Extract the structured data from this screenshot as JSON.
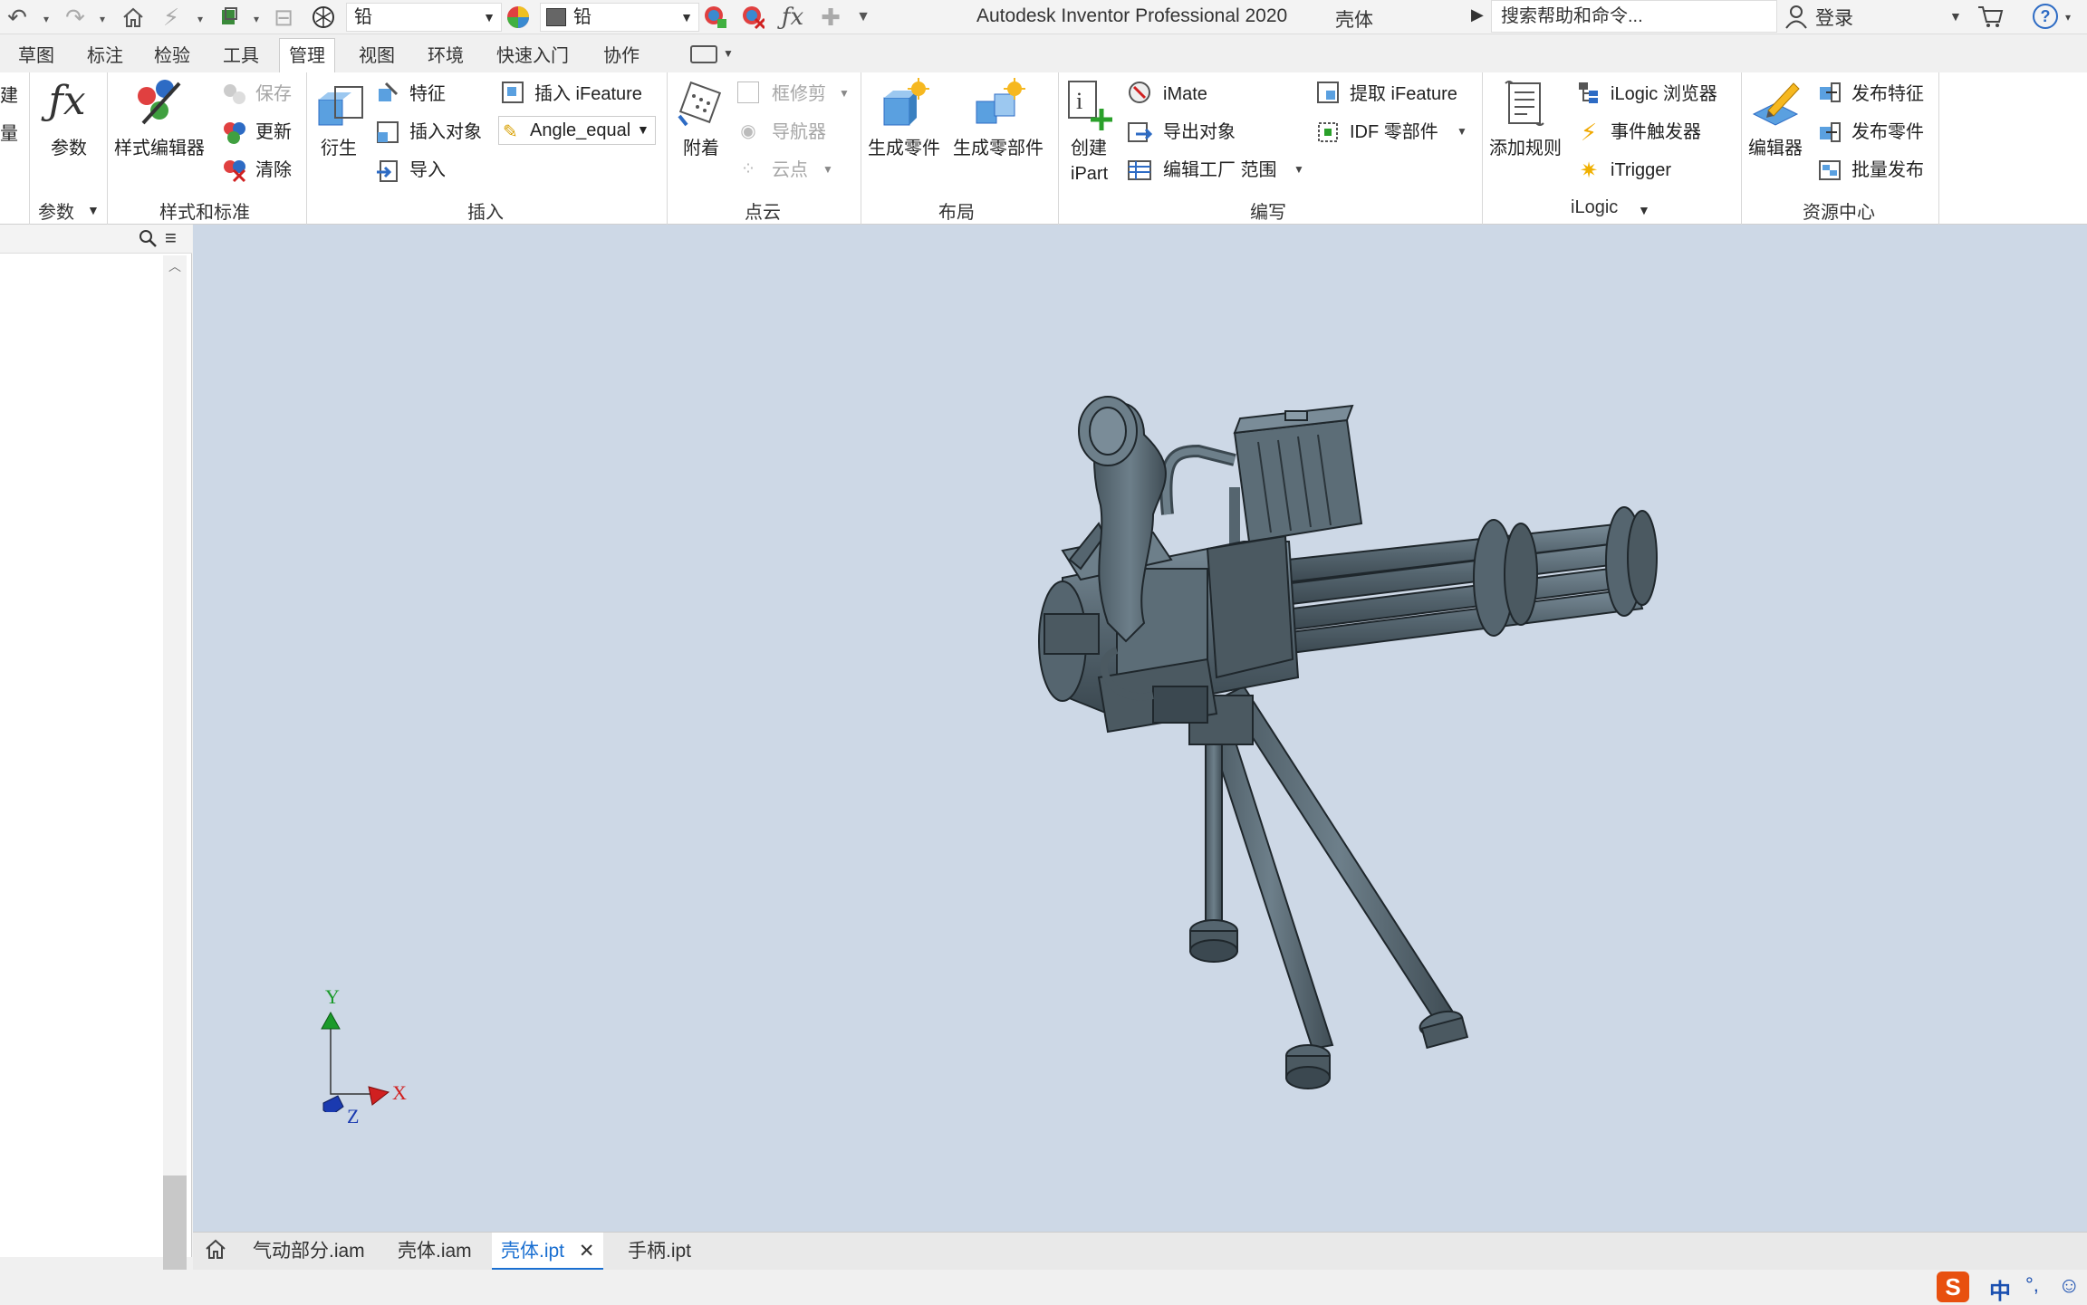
{
  "qat": {
    "material": "铅",
    "appearance": "铅"
  },
  "app_title": "Autodesk Inventor Professional 2020",
  "doc_title": "壳体",
  "search_placeholder": "搜索帮助和命令...",
  "login": "登录",
  "tabs": [
    "草图",
    "标注",
    "检验",
    "工具",
    "管理",
    "视图",
    "环境",
    "快速入门",
    "协作"
  ],
  "ribbon": {
    "left_partial": [
      "建",
      "量"
    ],
    "param": {
      "label": "参数",
      "panel": "参数"
    },
    "styles": {
      "editor": "样式编辑器",
      "save": "保存",
      "update": "更新",
      "purge": "清除",
      "panel": "样式和标准"
    },
    "insert": {
      "derive": "衍生",
      "feature": "特征",
      "insert_object": "插入对象",
      "import": "导入",
      "insert_ifeature": "插入 iFeature",
      "dropdown_value": "Angle_equal",
      "panel": "插入"
    },
    "pointcloud": {
      "attach": "附着",
      "crop": "框修剪",
      "navigator": "导航器",
      "points": "云点",
      "panel": "点云"
    },
    "layout": {
      "make_part": "生成零件",
      "make_components": "生成零部件",
      "panel": "布局"
    },
    "author": {
      "create_ipart": [
        "创建",
        "iPart"
      ],
      "imate": "iMate",
      "export_object": "导出对象",
      "factory_scope": "编辑工厂 范围",
      "extract_ifeature": "提取 iFeature",
      "idf": "IDF 零部件",
      "panel": "编写"
    },
    "ilogic": {
      "add_rule": "添加规则",
      "browser": "iLogic 浏览器",
      "event_trigger": "事件触发器",
      "itrigger": "iTrigger",
      "panel": "iLogic"
    },
    "content_center": {
      "editor": "编辑器",
      "publish_feature": "发布特征",
      "publish_part": "发布零件",
      "batch_publish": "批量发布",
      "panel": "资源中心"
    }
  },
  "axis": {
    "x": "X",
    "y": "Y",
    "z": "Z"
  },
  "doc_tabs": [
    {
      "label": "气动部分.iam"
    },
    {
      "label": "壳体.iam"
    },
    {
      "label": "壳体.ipt",
      "active": true
    },
    {
      "label": "手柄.ipt"
    }
  ],
  "ime": {
    "zh": "中",
    "punct": "°,"
  }
}
